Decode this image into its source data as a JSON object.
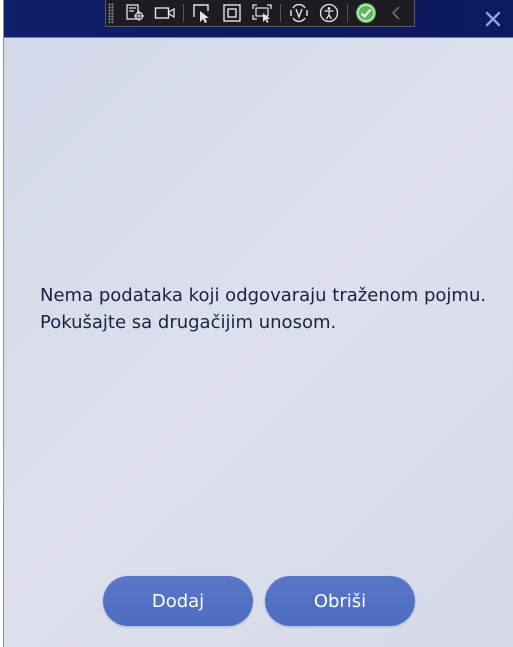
{
  "titlebar": {
    "close_icon": "close-icon",
    "toolbar": {
      "icons": [
        "live-visual-tree-icon",
        "video-record-icon",
        "select-element-icon",
        "display-layout-adorners-icon",
        "track-focused-element-icon",
        "hot-reload-icon",
        "accessibility-checker-icon",
        "binding-failures-ok-icon",
        "collapse-toolbar-icon"
      ]
    }
  },
  "message": {
    "line1": "Nema podataka koji odgovaraju traženom pojmu.",
    "line2": "Pokušajte sa drugačijim unosom."
  },
  "buttons": {
    "add_label": "Dodaj",
    "delete_label": "Obriši"
  },
  "colors": {
    "titlebar": "#0f1f6b",
    "content_bg": "#d8dcea",
    "button": "#5470c4",
    "text": "#1a2145",
    "check_ok": "#5cb85c"
  }
}
